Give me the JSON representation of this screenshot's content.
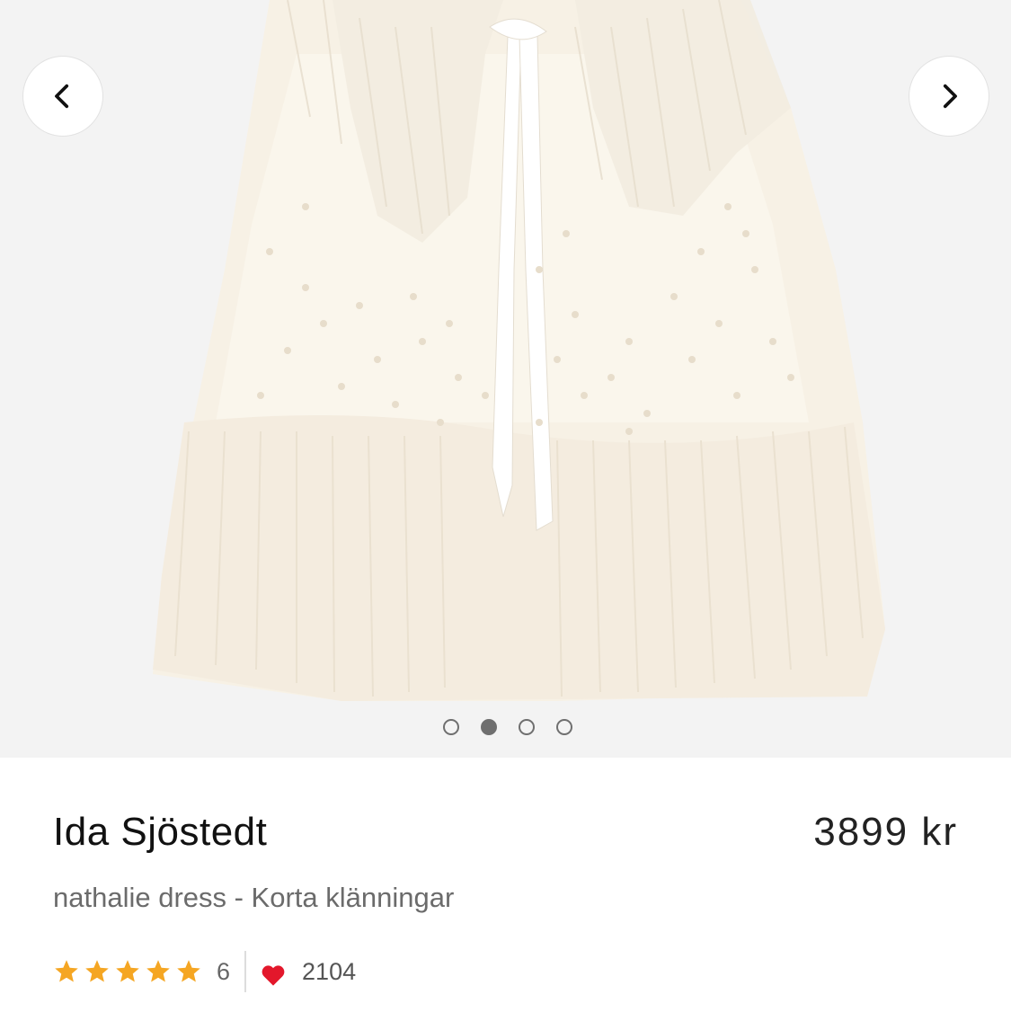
{
  "gallery": {
    "image_alt": "Ida Sjöstedt nathalie dress",
    "prev_icon": "chevron-left-icon",
    "next_icon": "chevron-right-icon",
    "slide_count": 4,
    "active_slide": 2
  },
  "product": {
    "brand": "Ida Sjöstedt",
    "price": "3899 kr",
    "subtitle": "nathalie dress - Korta klänningar",
    "rating": {
      "stars": 5,
      "count": "6",
      "star_color": "#f5a623"
    },
    "favorites": {
      "count": "2104",
      "heart_color": "#e3172b"
    }
  }
}
